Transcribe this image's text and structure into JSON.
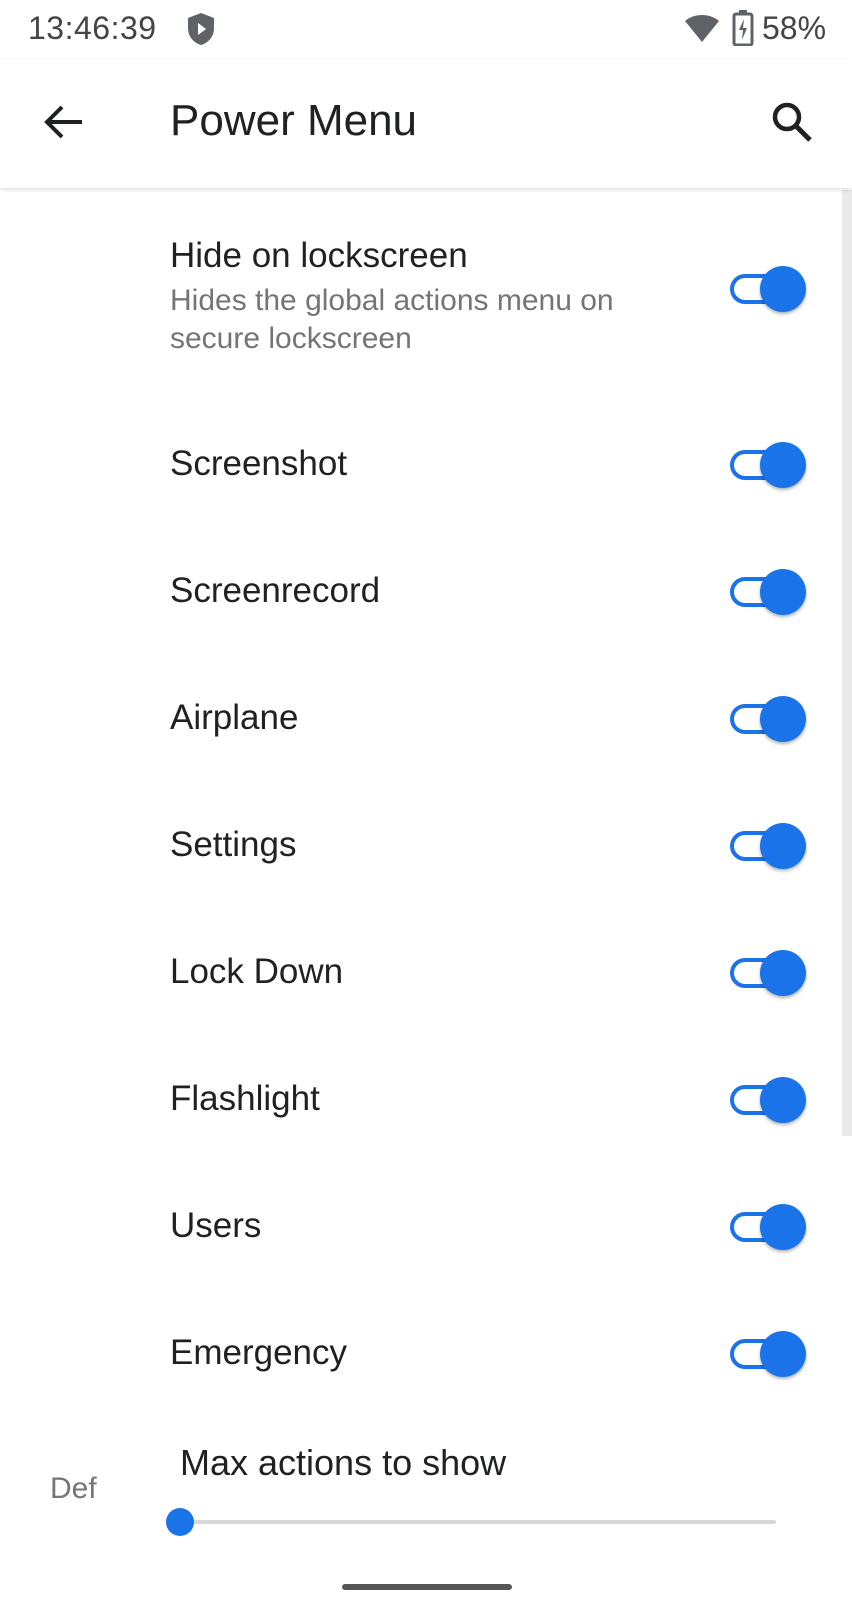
{
  "status_bar": {
    "time": "13:46:39",
    "battery_percent": "58%",
    "icons": [
      "shield-icon",
      "wifi-icon",
      "battery-charging-icon"
    ]
  },
  "app_bar": {
    "title": "Power Menu",
    "back_icon": "arrow-back-icon",
    "search_icon": "search-icon"
  },
  "accent_color": "#1a73e8",
  "settings": [
    {
      "title": "Hide on lockscreen",
      "subtitle": "Hides the global actions menu on secure lockscreen",
      "enabled": true
    },
    {
      "title": "Screenshot",
      "enabled": true
    },
    {
      "title": "Screenrecord",
      "enabled": true
    },
    {
      "title": "Airplane",
      "enabled": true
    },
    {
      "title": "Settings",
      "enabled": true
    },
    {
      "title": "Lock Down",
      "enabled": true
    },
    {
      "title": "Flashlight",
      "enabled": true
    },
    {
      "title": "Users",
      "enabled": true
    },
    {
      "title": "Emergency",
      "enabled": true
    }
  ],
  "max_actions": {
    "title": "Max actions to show",
    "value_label": "Def",
    "value_fraction": 0
  }
}
